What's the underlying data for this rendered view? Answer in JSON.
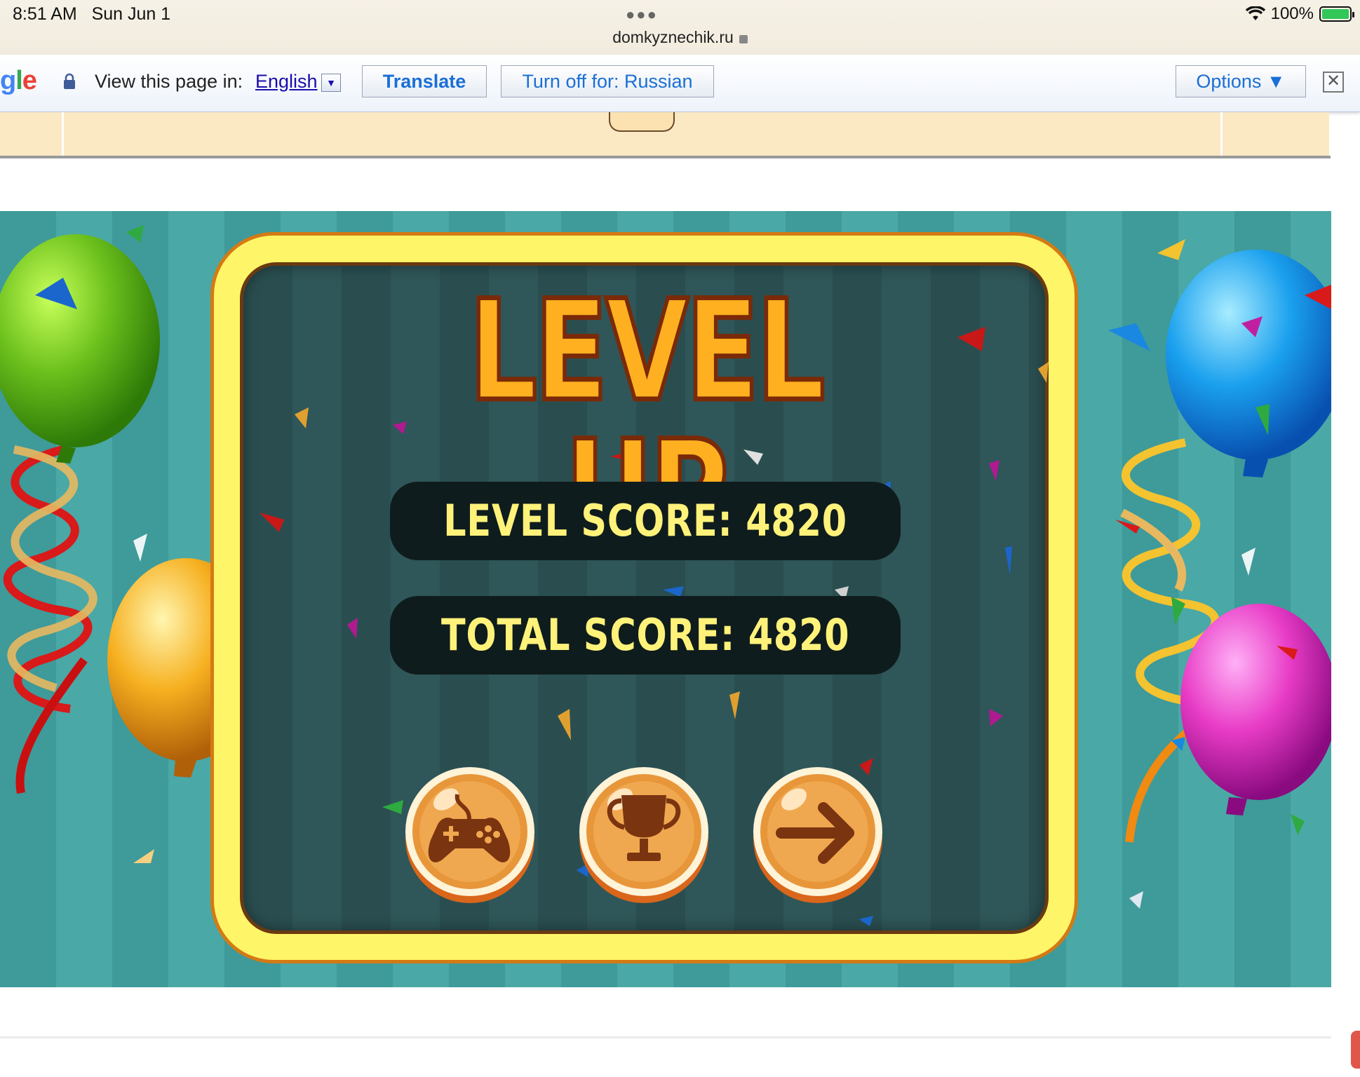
{
  "status_bar": {
    "time": "8:51 AM",
    "date": "Sun Jun 1",
    "url": "domkyznechik.ru",
    "battery": "100%"
  },
  "translate_bar": {
    "logo_parts": [
      "g",
      "l",
      "e"
    ],
    "view_label": "View this page in:",
    "language": "English",
    "translate_button": "Translate",
    "turn_off_button": "Turn off for: Russian",
    "options_button": "Options ▼",
    "close_symbol": "✕"
  },
  "game": {
    "title": "LEVEL UP",
    "level_score_label": "LEVEL SCORE: 4820",
    "total_score_label": "TOTAL SCORE: 4820",
    "level_score": 4820,
    "total_score": 4820,
    "buttons": [
      {
        "icon": "gamepad-icon"
      },
      {
        "icon": "trophy-icon"
      },
      {
        "icon": "arrow-right-icon"
      }
    ],
    "colors": {
      "frame_yellow": "#fff568",
      "board_dark": "#2a4e50",
      "title_orange": "#ffb020",
      "score_text": "#fff27a",
      "button_orange": "#e7963a"
    }
  }
}
